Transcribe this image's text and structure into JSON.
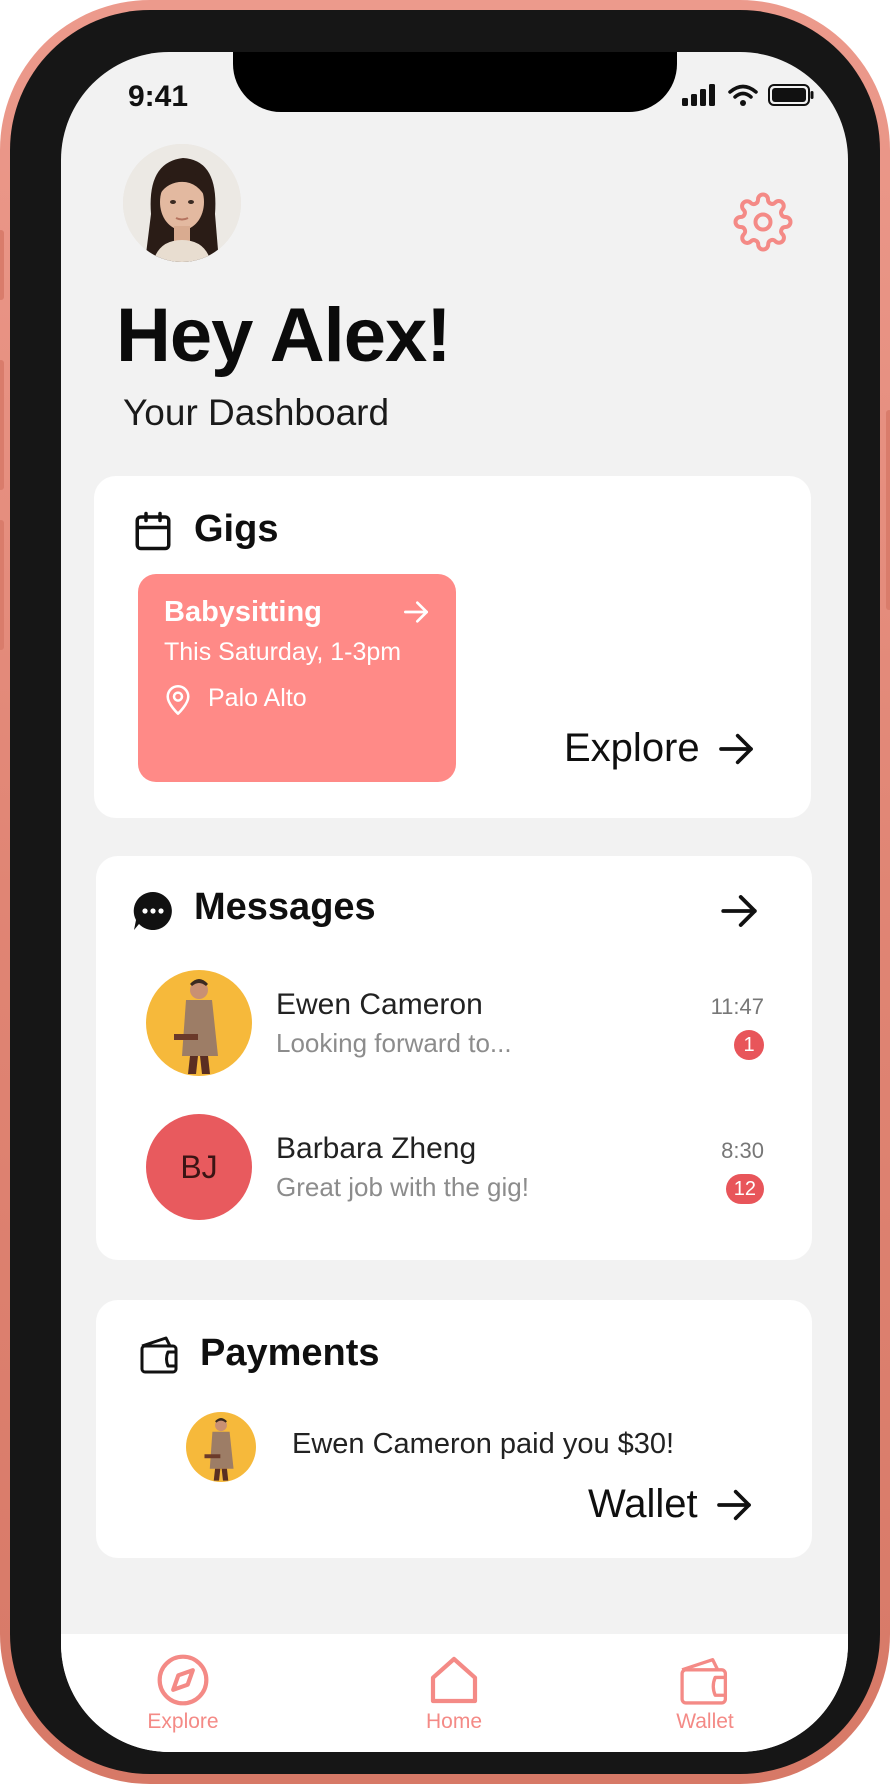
{
  "status_bar": {
    "time": "9:41"
  },
  "header": {
    "greeting": "Hey Alex!",
    "subtitle": "Your Dashboard"
  },
  "gigs": {
    "title": "Gigs",
    "item": {
      "title": "Babysitting",
      "time": "This Saturday, 1-3pm",
      "location": "Palo Alto"
    },
    "explore_label": "Explore"
  },
  "messages": {
    "title": "Messages",
    "items": [
      {
        "name": "Ewen Cameron",
        "preview": "Looking forward to...",
        "time": "11:47",
        "unread": "1"
      },
      {
        "name": "Barbara Zheng",
        "initials": "BJ",
        "preview": "Great job with the gig!",
        "time": "8:30",
        "unread": "12"
      }
    ]
  },
  "payments": {
    "title": "Payments",
    "text": "Ewen Cameron paid you $30!",
    "wallet_label": "Wallet"
  },
  "bottom_nav": {
    "items": [
      {
        "label": "Explore",
        "icon": "compass-icon"
      },
      {
        "label": "Home",
        "icon": "home-icon"
      },
      {
        "label": "Wallet",
        "icon": "wallet-icon"
      }
    ]
  },
  "colors": {
    "accent": "#f48a86",
    "gig_card": "#ff8a87",
    "badge": "#e8555a",
    "frame": "#e08574",
    "background": "#f2f2f2"
  }
}
